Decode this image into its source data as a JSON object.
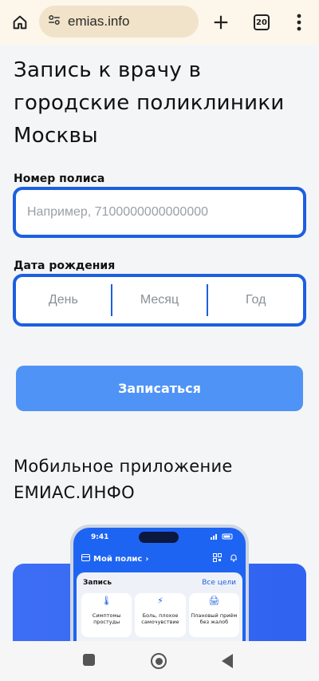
{
  "browser": {
    "url": "emias.info",
    "tab_count": "20"
  },
  "page": {
    "title": "Запись к врачу в городские поликлиники Москвы",
    "policy_label": "Номер полиса",
    "policy_placeholder": "Например, 7100000000000000",
    "dob_label": "Дата рождения",
    "dob_day": "День",
    "dob_month": "Месяц",
    "dob_year": "Год",
    "submit_label": "Записаться",
    "app_title": "Мобильное приложение ЕМИАС.ИНФО"
  },
  "phone": {
    "time": "9:41",
    "nav_title": "Мой полис",
    "card_title": "Запись",
    "card_link": "Все цели",
    "tiles": [
      {
        "label": "Симптомы простуды",
        "icon": "thermometer-icon"
      },
      {
        "label": "Боль, плохое самочувствие",
        "icon": "lightning-icon"
      },
      {
        "label": "Плановый приём без жалоб",
        "icon": "printer-icon"
      }
    ]
  },
  "colors": {
    "accent": "#1c5fe0",
    "button": "#4f93f7",
    "browser_bar": "#fdf6ea",
    "url_pill": "#f1e3c9"
  }
}
